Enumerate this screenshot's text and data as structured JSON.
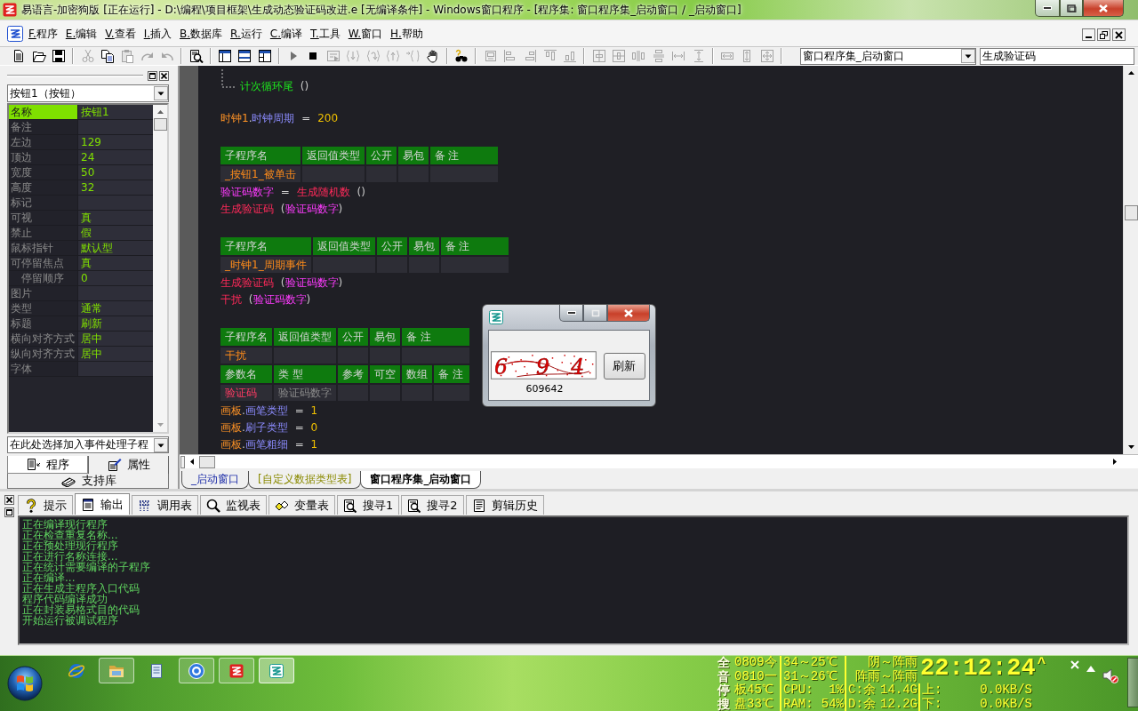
{
  "window": {
    "title": "易语言-加密狗版 [正在运行] - D:\\编程\\项目框架\\生成动态验证码改进.e [无编译条件] - Windows窗口程序 - [程序集: 窗口程序集_启动窗口 / _启动窗口]"
  },
  "menu": [
    "F.程序",
    "E.编辑",
    "V.查看",
    "I.插入",
    "B.数据库",
    "R.运行",
    "C.编译",
    "T.工具",
    "W.窗口",
    "H.帮助"
  ],
  "toolbar": {
    "buttons": [
      {
        "kind": "new",
        "disabled": false
      },
      {
        "kind": "open",
        "disabled": false
      },
      {
        "kind": "save",
        "disabled": false
      },
      {
        "kind": "separator"
      },
      {
        "kind": "cut",
        "disabled": true
      },
      {
        "kind": "copy",
        "disabled": false
      },
      {
        "kind": "paste",
        "disabled": true
      },
      {
        "kind": "redo",
        "disabled": true
      },
      {
        "kind": "undo",
        "disabled": true
      },
      {
        "kind": "separator"
      },
      {
        "kind": "find",
        "disabled": false
      },
      {
        "kind": "separator"
      },
      {
        "kind": "layout_side",
        "disabled": false
      },
      {
        "kind": "layout_split",
        "disabled": false
      },
      {
        "kind": "layout_grid",
        "disabled": false
      },
      {
        "kind": "separator"
      },
      {
        "kind": "run",
        "disabled": true
      },
      {
        "kind": "stop",
        "disabled": false
      },
      {
        "kind": "form_run",
        "disabled": true
      },
      {
        "kind": "step_in",
        "disabled": true
      },
      {
        "kind": "step_over",
        "disabled": true
      },
      {
        "kind": "step_out",
        "disabled": true
      },
      {
        "kind": "run_cursor",
        "disabled": true
      },
      {
        "kind": "hand",
        "disabled": false
      },
      {
        "kind": "separator"
      },
      {
        "kind": "binoculars",
        "disabled": false
      },
      {
        "kind": "separator"
      },
      {
        "kind": "frame",
        "disabled": true
      },
      {
        "kind": "align_left",
        "disabled": true
      },
      {
        "kind": "align_right",
        "disabled": true
      },
      {
        "kind": "align_top",
        "disabled": true
      },
      {
        "kind": "align_bottom",
        "disabled": true
      },
      {
        "kind": "separator"
      },
      {
        "kind": "center_h",
        "disabled": true
      },
      {
        "kind": "center_v",
        "disabled": true
      },
      {
        "kind": "space_h",
        "disabled": true
      },
      {
        "kind": "space_v",
        "disabled": true
      },
      {
        "kind": "spread_h",
        "disabled": true
      },
      {
        "kind": "spread_v",
        "disabled": true
      },
      {
        "kind": "separator"
      },
      {
        "kind": "same_width",
        "disabled": true
      },
      {
        "kind": "same_height",
        "disabled": true
      },
      {
        "kind": "same_size",
        "disabled": true
      },
      {
        "kind": "separator"
      }
    ],
    "module_selector": "窗口程序集_启动窗口",
    "subroutine_field": "生成验证码"
  },
  "properties_panel": {
    "object_selector": "按钮1（按钮）",
    "rows": [
      {
        "name": "名称",
        "value": "按钮1",
        "selected": true
      },
      {
        "name": "备注",
        "selected": false
      },
      {
        "name": "左边",
        "value": "129",
        "selected": false
      },
      {
        "name": "顶边",
        "value": "24",
        "selected": false
      },
      {
        "name": "宽度",
        "value": "50",
        "selected": false
      },
      {
        "name": "高度",
        "value": "32",
        "selected": false
      },
      {
        "name": "标记",
        "selected": false
      },
      {
        "name": "可视",
        "value": "真",
        "selected": false
      },
      {
        "name": "禁止",
        "value": "假",
        "selected": false
      },
      {
        "name": "鼠标指针",
        "value": "默认型",
        "selected": false
      },
      {
        "name": "可停留焦点",
        "value": "真",
        "selected": false,
        "children": [
          {
            "name": "停留顺序",
            "value": "0",
            "selected": false
          }
        ]
      },
      {
        "name": "图片",
        "selected": false
      },
      {
        "name": "类型",
        "value": "通常",
        "selected": false
      },
      {
        "name": "标题",
        "value": "刷新",
        "selected": false
      },
      {
        "name": "横向对齐方式",
        "value": "居中",
        "selected": false
      },
      {
        "name": "纵向对齐方式",
        "value": "居中",
        "selected": false
      },
      {
        "name": "字体",
        "selected": false
      }
    ],
    "event_selector": "在此处选择加入事件处理子程",
    "tabs": [
      {
        "label": "程序",
        "kind": "program",
        "selected": false
      },
      {
        "label": "属性",
        "kind": "properties",
        "selected": true
      }
    ],
    "library_tab": "支持库"
  },
  "editor": {
    "lines": [
      {
        "kind": "loop_end",
        "tokens": [
          {
            "text": "计次循环尾",
            "kind": "flow"
          },
          {
            "text": "()",
            "kind": "parens"
          }
        ]
      },
      {
        "kind": "blank"
      },
      {
        "kind": "code",
        "tokens": [
          {
            "text": "时钟1",
            "kind": "object"
          },
          {
            "text": ".",
            "kind": "dot"
          },
          {
            "text": "时钟周期",
            "kind": "property"
          },
          {
            "text": "=",
            "kind": "operator"
          },
          {
            "text": "200",
            "kind": "number"
          }
        ]
      },
      {
        "kind": "blank"
      },
      {
        "kind": "table",
        "sections": [
          {
            "header": [
              "子程序名",
              "返回值类型",
              "公开",
              "易包",
              "备 注"
            ],
            "cells": [
              {
                "text": "_按钮1_被单击",
                "kind": "subroutine"
              }
            ]
          }
        ]
      },
      {
        "kind": "code",
        "tokens": [
          {
            "text": "验证码数字",
            "kind": "variable"
          },
          {
            "text": "=",
            "kind": "operator"
          },
          {
            "text": "生成随机数",
            "kind": "command"
          },
          {
            "text": "()",
            "kind": "parens"
          }
        ]
      },
      {
        "kind": "code",
        "tokens": [
          {
            "text": "生成验证码",
            "kind": "command"
          },
          {
            "text": "(",
            "kind": "open"
          },
          {
            "text": "验证码数字",
            "kind": "variable"
          },
          {
            "text": ")",
            "kind": "close"
          }
        ]
      },
      {
        "kind": "blank"
      },
      {
        "kind": "table",
        "sections": [
          {
            "header": [
              "子程序名",
              "返回值类型",
              "公开",
              "易包",
              "备 注"
            ],
            "cells": [
              {
                "text": "_时钟1_周期事件",
                "kind": "subroutine"
              }
            ]
          }
        ]
      },
      {
        "kind": "code",
        "tokens": [
          {
            "text": "生成验证码",
            "kind": "command"
          },
          {
            "text": "(",
            "kind": "open"
          },
          {
            "text": "验证码数字",
            "kind": "variable"
          },
          {
            "text": ")",
            "kind": "close"
          }
        ]
      },
      {
        "kind": "code",
        "tokens": [
          {
            "text": "干扰",
            "kind": "command"
          },
          {
            "text": "(",
            "kind": "open"
          },
          {
            "text": "验证码数字",
            "kind": "variable"
          },
          {
            "text": ")",
            "kind": "close"
          }
        ]
      },
      {
        "kind": "blank"
      },
      {
        "kind": "table",
        "sections": [
          {
            "header": [
              "子程序名",
              "返回值类型",
              "公开",
              "易包",
              "备 注"
            ],
            "cells": [
              {
                "text": "干扰",
                "kind": "subroutine"
              }
            ]
          },
          {
            "header": [
              "参数名",
              "类 型",
              "参考",
              "可空",
              "数组",
              "备 注"
            ],
            "cells": [
              {
                "text": "验证码",
                "kind": "parameter"
              },
              {
                "text": "验证码数字",
                "kind": "datatype"
              }
            ]
          }
        ]
      },
      {
        "kind": "code",
        "tokens": [
          {
            "text": "画板",
            "kind": "object"
          },
          {
            "text": ".",
            "kind": "dot"
          },
          {
            "text": "画笔类型",
            "kind": "property"
          },
          {
            "text": "=",
            "kind": "operator"
          },
          {
            "text": "1",
            "kind": "number"
          }
        ]
      },
      {
        "kind": "code",
        "tokens": [
          {
            "text": "画板",
            "kind": "object"
          },
          {
            "text": ".",
            "kind": "dot"
          },
          {
            "text": "刷子类型",
            "kind": "property"
          },
          {
            "text": "=",
            "kind": "operator"
          },
          {
            "text": "0",
            "kind": "number"
          }
        ]
      },
      {
        "kind": "code",
        "tokens": [
          {
            "text": "画板",
            "kind": "object"
          },
          {
            "text": ".",
            "kind": "dot"
          },
          {
            "text": "画笔粗细",
            "kind": "property"
          },
          {
            "text": "=",
            "kind": "operator"
          },
          {
            "text": "1",
            "kind": "number"
          }
        ]
      }
    ],
    "tabs": [
      {
        "label": "_启动窗口",
        "kind": "window",
        "selected": false
      },
      {
        "label": "[自定义数据类型表]",
        "kind": "types",
        "selected": false
      },
      {
        "label": "窗口程序集_启动窗口",
        "kind": "module",
        "selected": true
      }
    ]
  },
  "dialog": {
    "captcha": [
      "6",
      "9",
      "4"
    ],
    "refresh_button": "刷新",
    "code": "609642"
  },
  "bottom_panel": {
    "tabs": [
      {
        "label": "提示",
        "kind": "hint",
        "selected": false
      },
      {
        "label": "输出",
        "kind": "output",
        "selected": true
      },
      {
        "label": "调用表",
        "kind": "calls",
        "selected": false
      },
      {
        "label": "监视表",
        "kind": "watch",
        "selected": false
      },
      {
        "label": "变量表",
        "kind": "variables",
        "selected": false
      },
      {
        "label": "搜寻1",
        "kind": "search",
        "selected": false
      },
      {
        "label": "搜寻2",
        "kind": "search",
        "selected": false
      },
      {
        "label": "剪辑历史",
        "kind": "history",
        "selected": false
      }
    ],
    "output": [
      "正在编译现行程序",
      "正在检查重复名称...",
      "正在预处理现行程序",
      "正在进行名称连接...",
      "正在统计需要编译的子程序",
      "正在编译...",
      "正在生成主程序入口代码",
      "程序代码编译成功",
      "正在封装易格式目的代码",
      "开始运行被调试程序"
    ]
  },
  "taskbar": {
    "apps": [
      {
        "kind": "browser",
        "running": false,
        "selected": false
      },
      {
        "kind": "folder",
        "running": true,
        "selected": false
      },
      {
        "kind": "notepad",
        "running": false,
        "selected": false
      },
      {
        "kind": "ring",
        "running": true,
        "selected": false
      },
      {
        "kind": "easy_red",
        "running": true,
        "selected": false
      },
      {
        "kind": "easy_teal",
        "running": true,
        "selected": true
      }
    ],
    "widget": {
      "keys": [
        "全",
        "音",
        "停",
        "搜"
      ],
      "forecast": [
        {
          "date": "0809今",
          "temp": "34～25℃",
          "weather": "阴～阵雨"
        },
        {
          "date": "0810一",
          "temp": "31～26℃",
          "weather": "阵雨～阵雨"
        }
      ],
      "clock": "22:12:24",
      "expand": "^",
      "sensors": [
        {
          "temp": "板45℃",
          "usage_label": "CPU:",
          "usage": "1%",
          "disk_label": "C:余",
          "disk": "14.4G",
          "net_label": "上:",
          "net": "0.0KB/S"
        },
        {
          "temp": "盘33℃",
          "usage_label": "RAM:",
          "usage": "54%",
          "disk_label": "D:余",
          "disk": "12.2G",
          "net_label": "下:",
          "net": "0.0KB/S"
        }
      ]
    },
    "tray": {
      "muted": true
    }
  }
}
